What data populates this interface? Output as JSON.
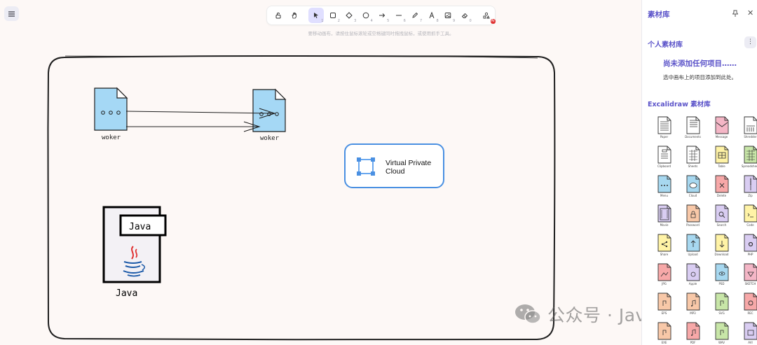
{
  "menu": {
    "icon": "hamburger-menu-icon"
  },
  "toolbar": {
    "tools": [
      {
        "name": "lock",
        "icon": "lock-icon",
        "num": ""
      },
      {
        "name": "hand",
        "icon": "hand-icon",
        "num": ""
      },
      {
        "name": "selection",
        "icon": "pointer-icon",
        "num": "1",
        "active": true
      },
      {
        "name": "rectangle",
        "icon": "rectangle-icon",
        "num": "2"
      },
      {
        "name": "diamond",
        "icon": "diamond-icon",
        "num": "3"
      },
      {
        "name": "ellipse",
        "icon": "ellipse-icon",
        "num": "4"
      },
      {
        "name": "arrow",
        "icon": "arrow-icon",
        "num": "5"
      },
      {
        "name": "line",
        "icon": "line-icon",
        "num": "6"
      },
      {
        "name": "draw",
        "icon": "pencil-icon",
        "num": "7"
      },
      {
        "name": "text",
        "icon": "text-icon",
        "num": "8"
      },
      {
        "name": "image",
        "icon": "image-icon",
        "num": "9"
      },
      {
        "name": "eraser",
        "icon": "eraser-icon",
        "num": "0"
      },
      {
        "name": "ai",
        "icon": "shapes-ai-icon",
        "num": ""
      }
    ],
    "ai_badge": "AI"
  },
  "hint": "要移动画布，请按住鼠标滚轮或空格键同时拖拽鼠标，或使用抓手工具。",
  "canvas": {
    "file_left_label": "woker",
    "file_right_label": "woker",
    "vpc_line1": "Virtual Private",
    "vpc_line2": "Cloud",
    "java_tag": "Java",
    "java_caption": "Java"
  },
  "watermark": "公众号 · JavaEdge",
  "sidebar": {
    "title": "素材库",
    "personal_title": "个人素材库",
    "more_icon": "⋮",
    "empty_title": "尚未添加任何项目……",
    "empty_subtitle": "选中画布上的项目添加到此处。",
    "excalidraw_title": "Excalidraw 素材库",
    "items": [
      {
        "caption": "Paper",
        "color": "#ffffff",
        "glyph": "lines"
      },
      {
        "caption": "Documents",
        "color": "#ffffff",
        "glyph": "stack"
      },
      {
        "caption": "Message",
        "color": "#f4b6c6",
        "glyph": "envelope"
      },
      {
        "caption": "Shredder",
        "color": "#ffffff",
        "glyph": "shred"
      },
      {
        "caption": "Clipboard",
        "color": "#ffffff",
        "glyph": "clip"
      },
      {
        "caption": "Sheets",
        "color": "#ffffff",
        "glyph": "grid"
      },
      {
        "caption": "Table",
        "color": "#fff3a6",
        "glyph": "table"
      },
      {
        "caption": "Spreadsheet",
        "color": "#c8e6a8",
        "glyph": "grid"
      },
      {
        "caption": "Menu",
        "color": "#a7d8f0",
        "glyph": "dots"
      },
      {
        "caption": "Cloud",
        "color": "#a7d8f0",
        "glyph": "cloud"
      },
      {
        "caption": "Delete",
        "color": "#f7a8a8",
        "glyph": "x"
      },
      {
        "caption": "Zip",
        "color": "#d9cdf2",
        "glyph": "zip"
      },
      {
        "caption": "Movie",
        "color": "#d9cdf2",
        "glyph": "film"
      },
      {
        "caption": "Password",
        "color": "#f8c8a8",
        "glyph": "lock"
      },
      {
        "caption": "Search",
        "color": "#d9cdf2",
        "glyph": "search"
      },
      {
        "caption": "Code",
        "color": "#fff3a6",
        "glyph": "code"
      },
      {
        "caption": "Share",
        "color": "#fff3a6",
        "glyph": "share"
      },
      {
        "caption": "Upload",
        "color": "#a7d8f0",
        "glyph": "up"
      },
      {
        "caption": "Download",
        "color": "#fff3a6",
        "glyph": "down"
      },
      {
        "caption": "PHP",
        "color": "#d9cdf2",
        "glyph": "gear"
      },
      {
        "caption": "JPG",
        "color": "#f7a8a8",
        "glyph": "img"
      },
      {
        "caption": "Apple",
        "color": "#d9cdf2",
        "glyph": "apple"
      },
      {
        "caption": "PSD",
        "color": "#a7d8f0",
        "glyph": "eye"
      },
      {
        "caption": "SKETCH",
        "color": "#f4b6c6",
        "glyph": "gem"
      },
      {
        "caption": "EPS",
        "color": "#f8c8a8",
        "glyph": "pen"
      },
      {
        "caption": "MP3",
        "color": "#f8c8a8",
        "glyph": "note"
      },
      {
        "caption": "SVG",
        "color": "#c8e6a8",
        "glyph": "pen"
      },
      {
        "caption": "REC",
        "color": "#f7a8a8",
        "glyph": "rec"
      },
      {
        "caption": "EXE",
        "color": "#f8c8a8",
        "glyph": "pen"
      },
      {
        "caption": "PDF",
        "color": "#f7a8a8",
        "glyph": "note"
      },
      {
        "caption": "WAV",
        "color": "#c8e6a8",
        "glyph": "pen"
      },
      {
        "caption": "AVI",
        "color": "#d9cdf2",
        "glyph": "disk"
      }
    ]
  }
}
